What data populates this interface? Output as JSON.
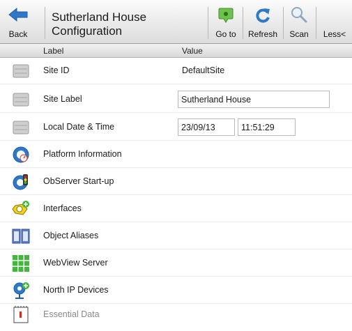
{
  "toolbar": {
    "back_label": "Back",
    "title_line1": "Sutherland House",
    "title_line2": "Configuration",
    "goto_label": "Go to",
    "refresh_label": "Refresh",
    "scan_label": "Scan",
    "less_label": "Less<"
  },
  "columns": {
    "label": "Label",
    "value": "Value"
  },
  "rows": [
    {
      "label": "Site ID",
      "value": "DefaultSite"
    },
    {
      "label": "Site Label",
      "value": "Sutherland House"
    },
    {
      "label": "Local Date & Time",
      "date": "23/09/13",
      "time": "11:51:29"
    },
    {
      "label": "Platform Information"
    },
    {
      "label": "ObServer Start-up"
    },
    {
      "label": "Interfaces"
    },
    {
      "label": "Object Aliases"
    },
    {
      "label": "WebView Server"
    },
    {
      "label": "North IP Devices"
    },
    {
      "label": "Essential Data"
    }
  ],
  "colors": {
    "accent_blue": "#2f78c8",
    "green": "#41b83a",
    "yellow": "#f2d21a",
    "red": "#d22a1f"
  }
}
